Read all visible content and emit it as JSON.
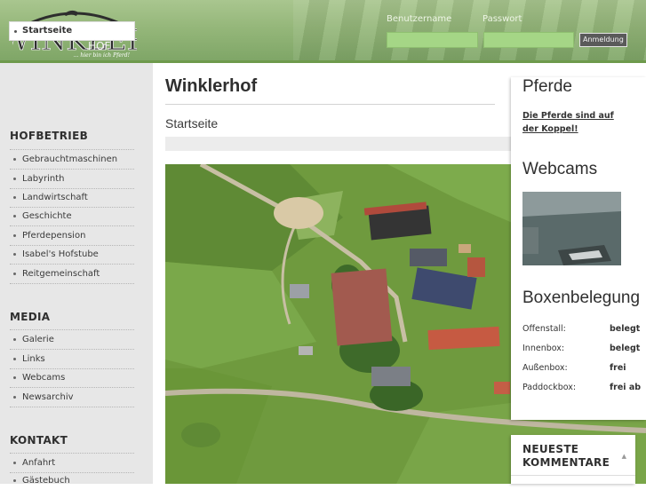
{
  "header": {
    "logo_text": "WINKLER HOF",
    "logo_tagline": "... hier bin ich Pferd!",
    "login": {
      "username_label": "Benutzername",
      "password_label": "Passwort",
      "username_value": "",
      "password_value": "",
      "submit_label": "Anmeldung"
    }
  },
  "sidebar": {
    "home": "Startseite",
    "sections": [
      {
        "title": "HOFBETRIEB",
        "items": [
          "Gebrauchtmaschinen",
          "Labyrinth",
          "Landwirtschaft",
          "Geschichte",
          "Pferdepension",
          "Isabel's Hofstube",
          "Reitgemeinschaft"
        ]
      },
      {
        "title": "MEDIA",
        "items": [
          "Galerie",
          "Links",
          "Webcams",
          "Newsarchiv"
        ]
      },
      {
        "title": "KONTAKT",
        "items": [
          "Anfahrt",
          "Gästebuch"
        ]
      }
    ]
  },
  "main": {
    "title": "Winklerhof",
    "subtitle": "Startseite"
  },
  "panel": {
    "pferde_title": "Pferde",
    "pferde_link": "Die Pferde sind auf der Koppel!",
    "webcams_title": "Webcams",
    "boxen_title": "Boxenbelegung",
    "boxen_rows": [
      {
        "label": "Offenstall:",
        "value": "belegt"
      },
      {
        "label": "Innenbox:",
        "value": "belegt"
      },
      {
        "label": "Außenbox:",
        "value": "frei"
      },
      {
        "label": "Paddockbox:",
        "value": "frei ab"
      }
    ],
    "comments_title": "NEUESTE KOMMENTARE"
  },
  "icons": {
    "bullet": "bullet-icon",
    "comments_toggle": "chevron-up-icon"
  },
  "colors": {
    "header_green": "#8fb374",
    "input_green": "#a5d686",
    "sidebar_bg": "#e7e7e7"
  }
}
